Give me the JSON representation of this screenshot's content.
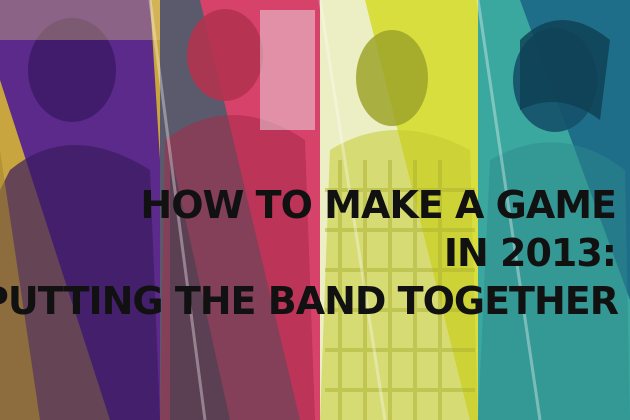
{
  "headline": {
    "line1": "HOW TO MAKE A GAME",
    "line2": "IN 2013:",
    "line3": "PUTTING THE BAND TOGETHER"
  },
  "panels": [
    {
      "name": "panel-1",
      "tint": "#c8a640",
      "base": "#5c2b8c"
    },
    {
      "name": "panel-2",
      "tint": "#d4416a",
      "base": "#56586a"
    },
    {
      "name": "panel-3",
      "tint": "#d9df3d",
      "base": "#eef0c8"
    },
    {
      "name": "panel-4",
      "tint": "#3aa7a0",
      "base": "#1f6f8a"
    }
  ]
}
